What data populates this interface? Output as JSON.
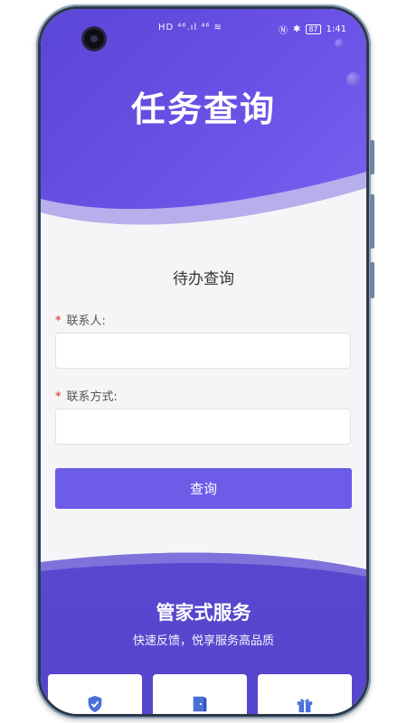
{
  "status_bar": {
    "left_icons": "HD ⁴⁶.ıl ⁴⁶ ≋",
    "battery": "87",
    "time": "1:41"
  },
  "header": {
    "title": "任务查询"
  },
  "form": {
    "title": "待办查询",
    "contact_label": "联系人:",
    "contact_value": "",
    "contact_placeholder": "",
    "phone_label": "联系方式:",
    "phone_value": "",
    "phone_placeholder": "",
    "required_mark": "*",
    "submit_label": "查询"
  },
  "service": {
    "title": "管家式服务",
    "subtitle": "快速反馈，悦享服务高品质",
    "cards": [
      {
        "icon": "shield-check-icon"
      },
      {
        "icon": "door-icon"
      },
      {
        "icon": "gift-icon"
      }
    ]
  },
  "colors": {
    "accent": "#6c5ce7",
    "header_start": "#5a46d6",
    "header_end": "#7a62f2",
    "required": "#e02020"
  }
}
